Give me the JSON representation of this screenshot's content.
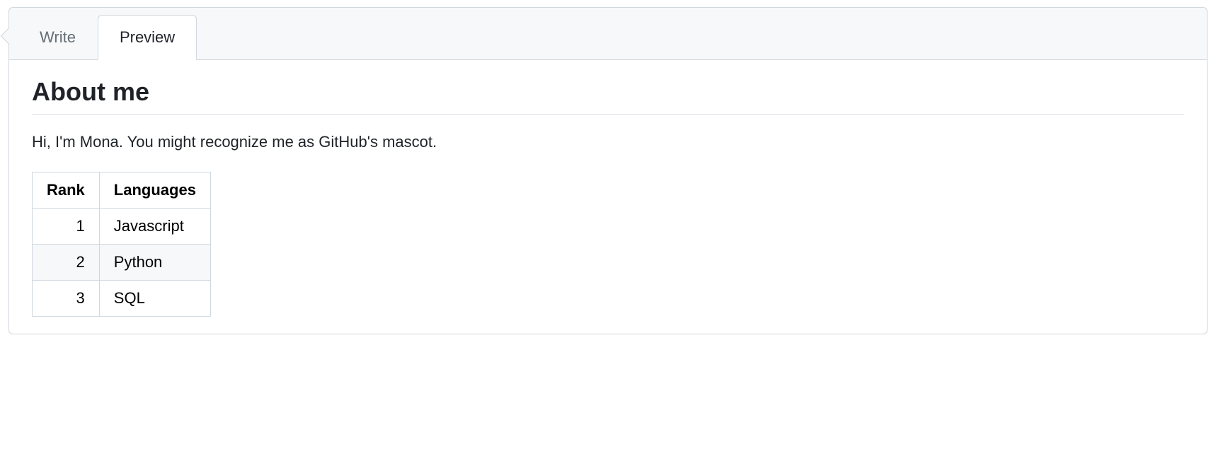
{
  "tabs": {
    "write": "Write",
    "preview": "Preview"
  },
  "content": {
    "heading": "About me",
    "intro": "Hi, I'm Mona. You might recognize me as GitHub's mascot.",
    "table": {
      "headers": {
        "rank": "Rank",
        "languages": "Languages"
      },
      "rows": [
        {
          "rank": "1",
          "language": "Javascript"
        },
        {
          "rank": "2",
          "language": "Python"
        },
        {
          "rank": "3",
          "language": "SQL"
        }
      ]
    }
  }
}
